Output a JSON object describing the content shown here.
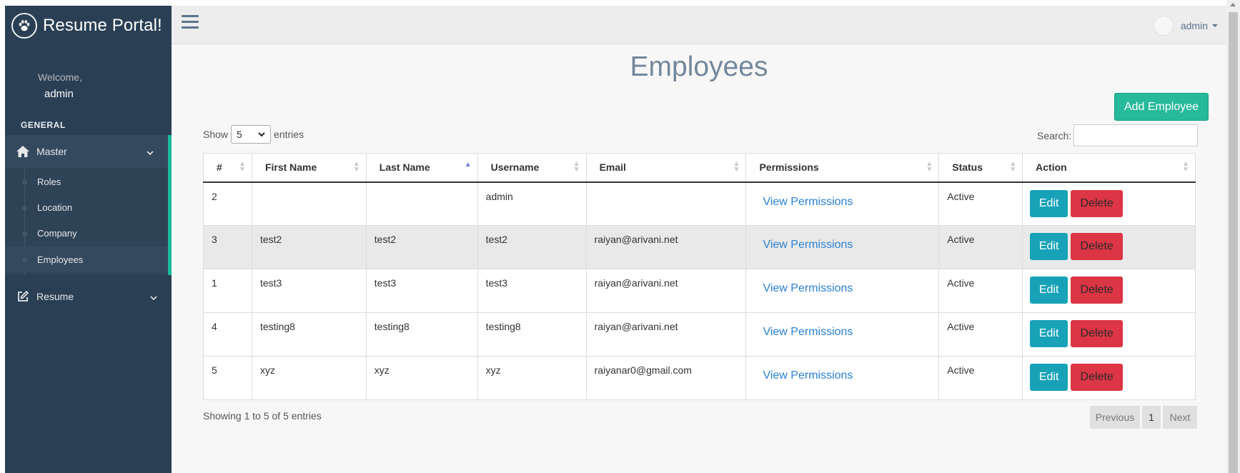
{
  "sidebar": {
    "brand": "Resume Portal!",
    "welcome_label": "Welcome,",
    "welcome_name": "admin",
    "section_title": "GENERAL",
    "master_label": "Master",
    "submenu": [
      {
        "label": "Roles"
      },
      {
        "label": "Location"
      },
      {
        "label": "Company"
      },
      {
        "label": "Employees"
      }
    ],
    "resume_label": "Resume"
  },
  "topnav": {
    "user_name": "admin"
  },
  "page": {
    "title": "Employees",
    "add_button": "Add Employee",
    "show_label": "Show",
    "show_value": "5",
    "entries_label": "entries",
    "search_label": "Search:",
    "search_value": ""
  },
  "table": {
    "headers": [
      "#",
      "First Name",
      "Last Name",
      "Username",
      "Email",
      "Permissions",
      "Status",
      "Action"
    ],
    "sorted_column": "Last Name",
    "sort_direction": "ascending",
    "rows": [
      {
        "id": "2",
        "first": "",
        "last": "",
        "username": "admin",
        "email": "",
        "permissions": "View Permissions",
        "status": "Active",
        "edit": "Edit",
        "delete": "Delete"
      },
      {
        "id": "3",
        "first": "test2",
        "last": "test2",
        "username": "test2",
        "email": "raiyan@arivani.net",
        "permissions": "View Permissions",
        "status": "Active",
        "edit": "Edit",
        "delete": "Delete"
      },
      {
        "id": "1",
        "first": "test3",
        "last": "test3",
        "username": "test3",
        "email": "raiyan@arivani.net",
        "permissions": "View Permissions",
        "status": "Active",
        "edit": "Edit",
        "delete": "Delete"
      },
      {
        "id": "4",
        "first": "testing8",
        "last": "testing8",
        "username": "testing8",
        "email": "raiyan@arivani.net",
        "permissions": "View Permissions",
        "status": "Active",
        "edit": "Edit",
        "delete": "Delete"
      },
      {
        "id": "5",
        "first": "xyz",
        "last": "xyz",
        "username": "xyz",
        "email": "raiyanar0@gmail.com",
        "permissions": "View Permissions",
        "status": "Active",
        "edit": "Edit",
        "delete": "Delete"
      }
    ]
  },
  "footer": {
    "info": "Showing 1 to 5 of 5 entries",
    "previous": "Previous",
    "page": "1",
    "next": "Next"
  },
  "colors": {
    "sidebar_bg": "#2a3f54",
    "accent": "#1abb9c",
    "add_button": "#26b99a",
    "edit_button": "#17a2b8",
    "delete_button": "#dc3545",
    "link": "#2a82d6"
  },
  "icons": {
    "brand": "paw-icon",
    "master": "home-icon",
    "resume": "edit-icon",
    "menu": "hamburger-icon"
  }
}
